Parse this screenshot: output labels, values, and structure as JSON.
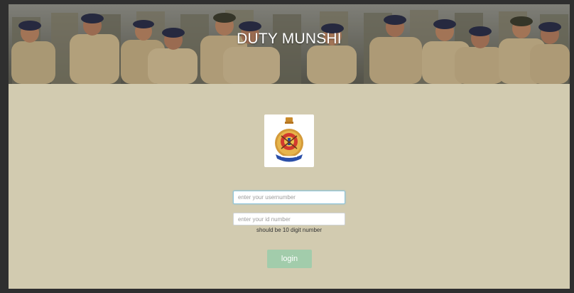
{
  "banner": {
    "title": "DUTY MUNSHI"
  },
  "login_form": {
    "username_placeholder": "enter your usernumber",
    "id_placeholder": "enter your id number",
    "id_hint": "should be 10 digit number",
    "login_label": "login"
  },
  "colors": {
    "page_background": "#d2cbb0",
    "login_button": "#a2ccab",
    "focus_border": "#8fc4d8"
  },
  "icons": {
    "emblem": "police-emblem-icon"
  }
}
